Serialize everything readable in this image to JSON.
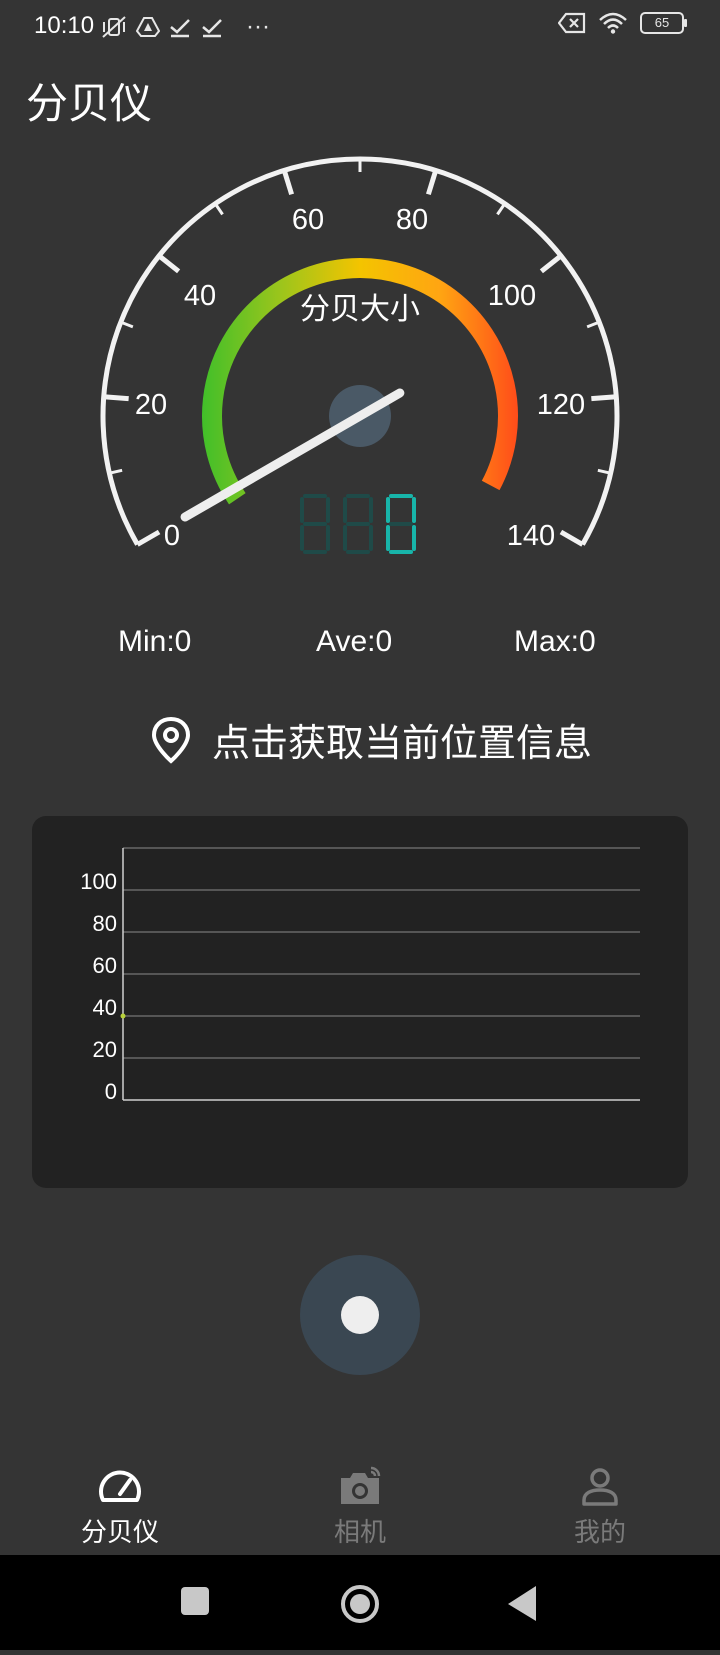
{
  "status_bar": {
    "time": "10:10",
    "left_icons": [
      "mute-vibrate-icon",
      "drive-icon",
      "check-icon",
      "check-icon",
      "more-dots-icon"
    ],
    "right_icons": [
      "no-sim-icon",
      "wifi-icon"
    ],
    "battery": "65",
    "more": "···"
  },
  "app": {
    "title": "分贝仪"
  },
  "gauge": {
    "label": "分贝大小",
    "scale_labels": [
      "0",
      "20",
      "40",
      "60",
      "80",
      "100",
      "120",
      "140"
    ],
    "min_value": 0,
    "max_value": 140,
    "needle_value": 0,
    "digital_display": "0",
    "colors": {
      "green": "#4cc02a",
      "yellow": "#f5c400",
      "orange": "#ff7a1a",
      "red": "#ff4a1a",
      "digit": "#18b5aa",
      "digit_off": "#1f4a48"
    }
  },
  "stats": {
    "min": "Min:0",
    "ave": "Ave:0",
    "max": "Max:0"
  },
  "location": {
    "text": "点击获取当前位置信息",
    "icon": "location-pin-icon"
  },
  "chart_data": {
    "type": "line",
    "y_tick_labels": [
      "0",
      "20",
      "40",
      "60",
      "80",
      "100"
    ],
    "ylim": [
      0,
      120
    ],
    "series": [
      {
        "values": [
          40
        ]
      }
    ],
    "grid": true
  },
  "record": {
    "icon": "record-icon"
  },
  "bottom_nav": {
    "items": [
      {
        "label": "分贝仪",
        "icon": "speedometer-icon",
        "active": true
      },
      {
        "label": "相机",
        "icon": "camera-icon",
        "active": false
      },
      {
        "label": "我的",
        "icon": "person-icon",
        "active": false
      }
    ],
    "active_color": "#ffffff",
    "inactive_color": "#7a7a7a"
  },
  "system_nav": {
    "icons": [
      "recents-icon",
      "home-icon",
      "back-icon"
    ]
  }
}
